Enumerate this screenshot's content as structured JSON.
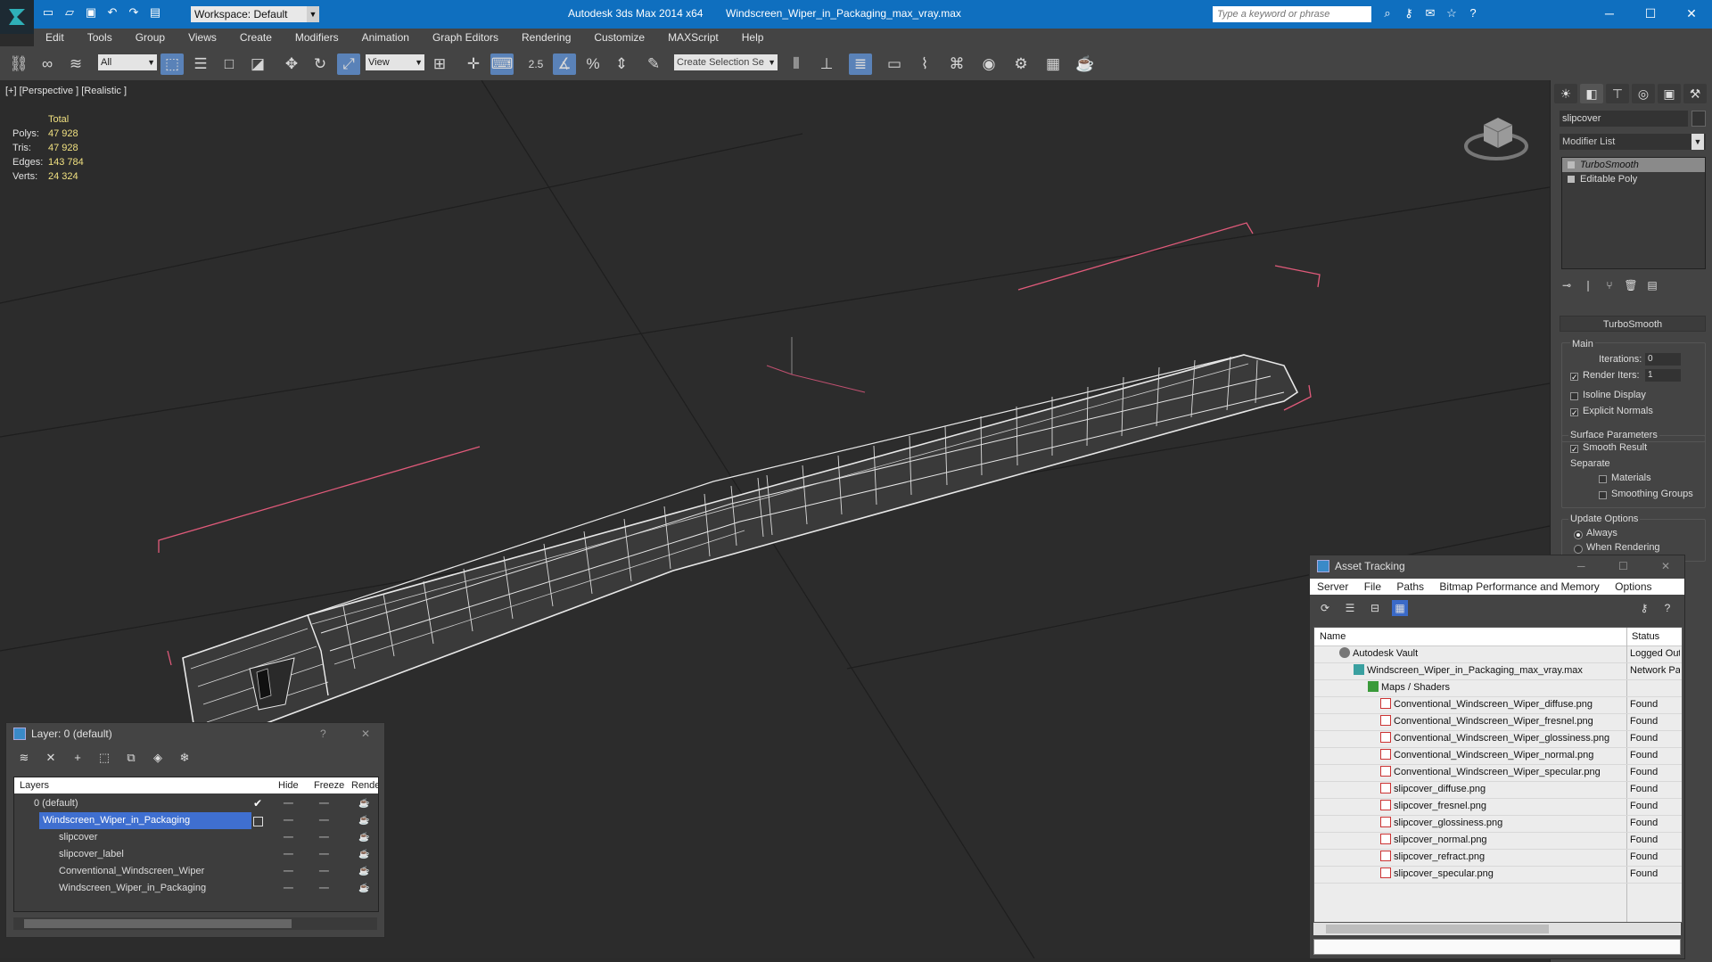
{
  "titlebar": {
    "workspace": "Workspace: Default",
    "app_title": "Autodesk 3ds Max  2014 x64",
    "file_title": "Windscreen_Wiper_in_Packaging_max_vray.max",
    "search_placeholder": "Type a keyword or phrase"
  },
  "menu": [
    "Edit",
    "Tools",
    "Group",
    "Views",
    "Create",
    "Modifiers",
    "Animation",
    "Graph Editors",
    "Rendering",
    "Customize",
    "MAXScript",
    "Help"
  ],
  "toolbar": {
    "filter_value": "All",
    "refcoord_value": "View",
    "angle_snap_label": "2.5",
    "selection_set_placeholder": "Create Selection Se"
  },
  "viewport": {
    "label": "[+] [Perspective ] [Realistic ]",
    "stats_header": "Total",
    "stats": [
      {
        "k": "Polys:",
        "v": "47 928"
      },
      {
        "k": "Tris:",
        "v": "47 928"
      },
      {
        "k": "Edges:",
        "v": "143 784"
      },
      {
        "k": "Verts:",
        "v": "24 324"
      }
    ]
  },
  "command_panel": {
    "object_name": "slipcover",
    "modifier_list": "Modifier List",
    "stack": [
      "TurboSmooth",
      "Editable Poly"
    ],
    "rollout_title": "TurboSmooth",
    "main_label": "Main",
    "iterations_label": "Iterations:",
    "iterations_value": "0",
    "render_iters_label": "Render Iters:",
    "render_iters_value": "1",
    "isoline_label": "Isoline Display",
    "explicit_normals_label": "Explicit Normals",
    "surface_params_label": "Surface Parameters",
    "smooth_result_label": "Smooth Result",
    "separate_label": "Separate",
    "materials_label": "Materials",
    "smoothing_groups_label": "Smoothing Groups",
    "update_options_label": "Update Options",
    "always_label": "Always",
    "when_rendering_label": "When Rendering"
  },
  "layer_dialog": {
    "title": "Layer: 0 (default)",
    "help": "?",
    "columns": {
      "layers": "Layers",
      "hide": "Hide",
      "freeze": "Freeze",
      "render": "Render"
    },
    "rows": [
      {
        "name": "0 (default)"
      },
      {
        "name": "Windscreen_Wiper_in_Packaging"
      },
      {
        "name": "slipcover"
      },
      {
        "name": "slipcover_label"
      },
      {
        "name": "Conventional_Windscreen_Wiper"
      },
      {
        "name": "Windscreen_Wiper_in_Packaging"
      }
    ]
  },
  "asset_dialog": {
    "title": "Asset Tracking",
    "menu": [
      "Server",
      "File",
      "Paths",
      "Bitmap Performance and Memory",
      "Options"
    ],
    "columns": {
      "name": "Name",
      "status": "Status"
    },
    "rows": [
      {
        "name": "Autodesk Vault",
        "status": "Logged Out"
      },
      {
        "name": "Windscreen_Wiper_in_Packaging_max_vray.max",
        "status": "Network Path"
      },
      {
        "name": "Maps / Shaders",
        "status": ""
      },
      {
        "name": "Conventional_Windscreen_Wiper_diffuse.png",
        "status": "Found"
      },
      {
        "name": "Conventional_Windscreen_Wiper_fresnel.png",
        "status": "Found"
      },
      {
        "name": "Conventional_Windscreen_Wiper_glossiness.png",
        "status": "Found"
      },
      {
        "name": "Conventional_Windscreen_Wiper_normal.png",
        "status": "Found"
      },
      {
        "name": "Conventional_Windscreen_Wiper_specular.png",
        "status": "Found"
      },
      {
        "name": "slipcover_diffuse.png",
        "status": "Found"
      },
      {
        "name": "slipcover_fresnel.png",
        "status": "Found"
      },
      {
        "name": "slipcover_glossiness.png",
        "status": "Found"
      },
      {
        "name": "slipcover_normal.png",
        "status": "Found"
      },
      {
        "name": "slipcover_refract.png",
        "status": "Found"
      },
      {
        "name": "slipcover_specular.png",
        "status": "Found"
      }
    ]
  },
  "colors": {
    "titlebar": "#0f6fbf",
    "selection": "#3f6fd0",
    "wire": "#e8e8e8",
    "bounding_box": "#e05a7a"
  }
}
